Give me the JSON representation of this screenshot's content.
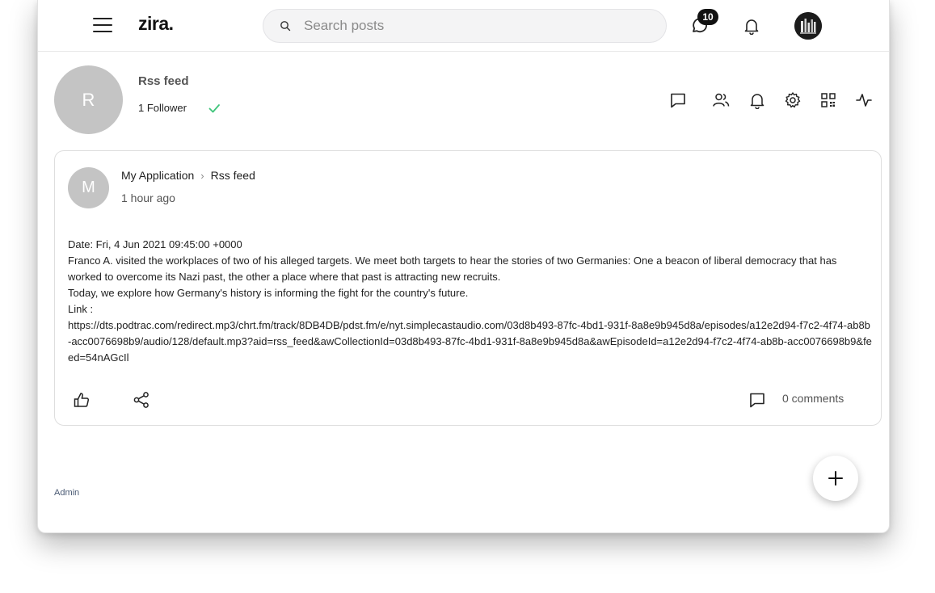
{
  "header": {
    "logo": "zira.",
    "search_placeholder": "Search posts",
    "chat_badge": "10",
    "icons": [
      "menu-icon",
      "search-icon",
      "chat-icon",
      "bell-icon",
      "user-avatar"
    ]
  },
  "profile": {
    "initial": "R",
    "name": "Rss feed",
    "followers": "1 Follower",
    "action_icons": [
      "message-icon",
      "members-icon",
      "bell-icon",
      "gear-icon",
      "qr-code-icon",
      "activity-icon"
    ]
  },
  "post": {
    "author_initial": "M",
    "breadcrumb": [
      "My Application",
      "Rss feed"
    ],
    "time": "1 hour ago",
    "lines": [
      "Date: Fri, 4 Jun 2021 09:45:00 +0000",
      "Franco A. visited the workplaces of two of his alleged targets. We meet both targets to hear the stories of two Germanies: One a beacon of liberal democracy that has worked to overcome its Nazi past, the other a place where that past is attracting new recruits.",
      "Today, we explore how Germany's history is informing the fight for the country's future.",
      "Link :"
    ],
    "link": "https://dts.podtrac.com/redirect.mp3/chrt.fm/track/8DB4DB/pdst.fm/e/nyt.simplecastaudio.com/03d8b493-87fc-4bd1-931f-8a8e9b945d8a/episodes/a12e2d94-f7c2-4f74-ab8b-acc0076698b9/audio/128/default.mp3?aid=rss_feed&awCollectionId=03d8b493-87fc-4bd1-931f-8a8e9b945d8a&awEpisodeId=a12e2d94-f7c2-4f74-ab8b-acc0076698b9&feed=54nAGcIl",
    "comments": "0 comments"
  },
  "footer": {
    "admin": "Admin"
  },
  "colors": {
    "check": "#3ec47a",
    "avatar_gray": "#c4c4c4",
    "badge": "#111111"
  }
}
